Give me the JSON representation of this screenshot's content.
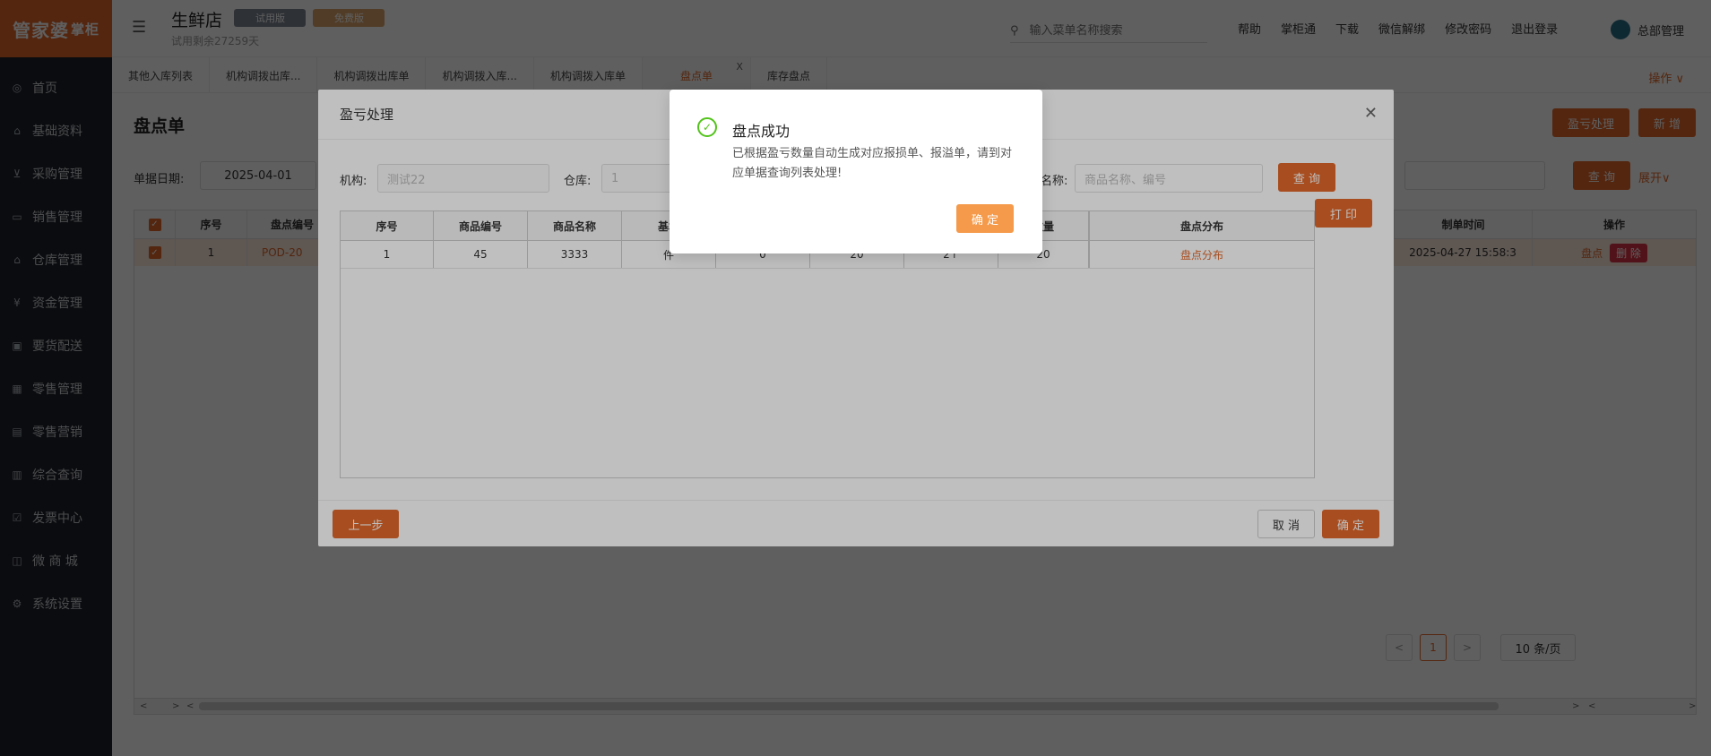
{
  "app": {
    "logo_main": "管家婆",
    "logo_sub": "掌柜",
    "store_name": "生鲜店",
    "trial_text": "试用剩余27259天",
    "badge_trial": "试用版",
    "badge_vip": "免费版"
  },
  "colors": {
    "accent": "#e0672a",
    "sidebar_bg": "#1f2229",
    "success": "#52c41a",
    "danger": "#dd3344"
  },
  "sidebar": {
    "items": [
      {
        "label": "首页",
        "icon": "globe-icon"
      },
      {
        "label": "基础资料",
        "icon": "home-icon"
      },
      {
        "label": "采购管理",
        "icon": "cart-icon"
      },
      {
        "label": "销售管理",
        "icon": "card-icon"
      },
      {
        "label": "仓库管理",
        "icon": "warehouse-icon"
      },
      {
        "label": "资金管理",
        "icon": "money-icon"
      },
      {
        "label": "要货配送",
        "icon": "delivery-icon"
      },
      {
        "label": "零售管理",
        "icon": "chart-icon"
      },
      {
        "label": "零售营销",
        "icon": "gift-icon"
      },
      {
        "label": "综合查询",
        "icon": "bar-chart-icon"
      },
      {
        "label": "发票中心",
        "icon": "invoice-icon"
      },
      {
        "label": "微 商 城",
        "icon": "bag-icon"
      },
      {
        "label": "系统设置",
        "icon": "gear-icon"
      }
    ]
  },
  "topbar": {
    "search_placeholder": "输入菜单名称搜索",
    "links": [
      "帮助",
      "掌柜通",
      "下载",
      "微信解绑",
      "修改密码",
      "退出登录"
    ],
    "user": "总部管理"
  },
  "tabs": [
    {
      "label": "其他入库列表",
      "active": false
    },
    {
      "label": "机构调拨出库...",
      "active": false
    },
    {
      "label": "机构调拨出库单",
      "active": false
    },
    {
      "label": "机构调拨入库...",
      "active": false
    },
    {
      "label": "机构调拨入库单",
      "active": false
    },
    {
      "label": "盘点单",
      "active": true
    },
    {
      "label": "库存盘点",
      "active": false
    }
  ],
  "tabs_ops": "操作 ∨",
  "main": {
    "title": "盘点单",
    "btn_profit_loss": "盈亏处理",
    "btn_new": "新 增",
    "date_label": "单据日期:",
    "date_value": "2025-04-01",
    "btn_query": "查 询",
    "expand": "展开∨",
    "grid_headers": {
      "seq": "序号",
      "code": "盘点编号",
      "time": "制单时间",
      "ops": "操作"
    },
    "grid_row": {
      "seq": "1",
      "code": "POD-20",
      "time": "2025-04-27 15:58:3",
      "op_check": "盘点",
      "op_delete": "删 除"
    }
  },
  "pager": {
    "current": "1",
    "page_size": "10 条/页"
  },
  "modal": {
    "title": "盈亏处理",
    "org_label": "机构:",
    "org_value": "测试22",
    "wh_label": "仓库:",
    "wh_value": "1",
    "name_label": "名称:",
    "name_placeholder": "商品名称、编号",
    "btn_query": "查 询",
    "btn_print": "打 印",
    "headers": [
      "序号",
      "商品编号",
      "商品名称",
      "基本",
      "",
      "",
      "",
      "数量",
      "盘点分布"
    ],
    "row": [
      "1",
      "45",
      "3333",
      "件",
      "0",
      "20",
      "2↑",
      "20",
      "盘点分布"
    ],
    "btn_prev": "上一步",
    "btn_cancel": "取 消",
    "btn_ok": "确 定"
  },
  "dialog": {
    "title": "盘点成功",
    "message": "已根据盈亏数量自动生成对应报损单、报溢单，请到对应单据查询列表处理!",
    "btn_ok": "确 定"
  }
}
